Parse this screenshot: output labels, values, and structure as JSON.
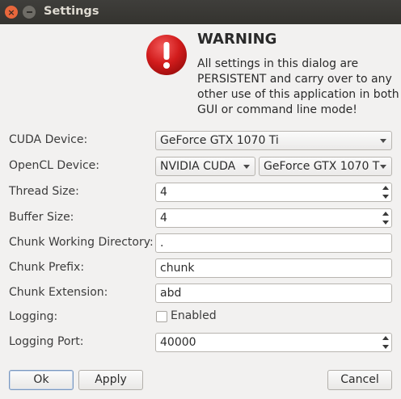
{
  "window": {
    "title": "Settings"
  },
  "warning": {
    "heading": "WARNING",
    "message": "All settings in this dialog are PERSISTENT and carry over to any other use of this application in both GUI or command line mode!"
  },
  "form": {
    "cuda_device": {
      "label": "CUDA Device:",
      "value": "GeForce GTX 1070 Ti"
    },
    "opencl_device": {
      "label": "OpenCL Device:",
      "platform": "NVIDIA CUDA",
      "device": "GeForce GTX 1070 T"
    },
    "thread_size": {
      "label": "Thread Size:",
      "value": "4"
    },
    "buffer_size": {
      "label": "Buffer Size:",
      "value": "4"
    },
    "chunk_dir": {
      "label": "Chunk Working Directory:",
      "value": "."
    },
    "chunk_prefix": {
      "label": "Chunk Prefix:",
      "value": "chunk"
    },
    "chunk_ext": {
      "label": "Chunk Extension:",
      "value": "abd"
    },
    "logging": {
      "label": "Logging:",
      "checkbox_label": "Enabled",
      "checked": false
    },
    "logging_port": {
      "label": "Logging Port:",
      "value": "40000"
    }
  },
  "buttons": {
    "ok": "Ok",
    "apply": "Apply",
    "cancel": "Cancel"
  },
  "colors": {
    "titlebar": "#3c3b37",
    "close_button": "#e8673c",
    "warning_icon": "#d21c1c",
    "dialog_bg": "#f2f1f0"
  }
}
